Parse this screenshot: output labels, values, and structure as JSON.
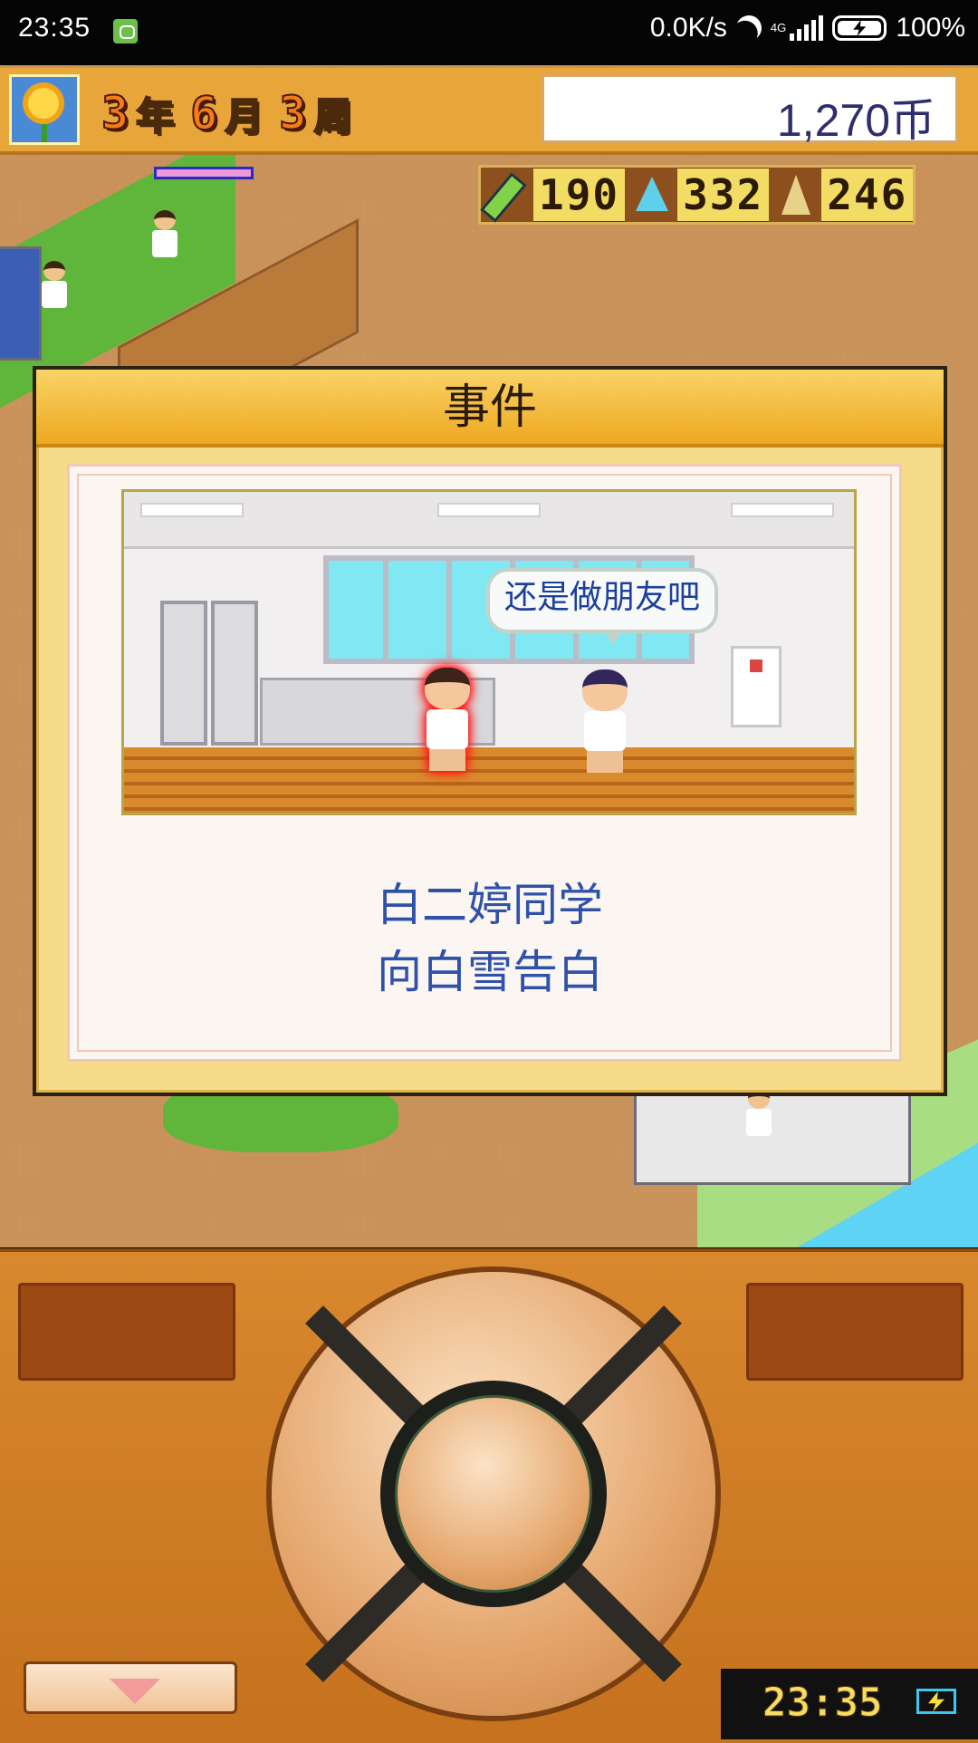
{
  "status_bar": {
    "time": "23:35",
    "net_speed": "0.0K/s",
    "network": "4G",
    "battery": "100%"
  },
  "hud": {
    "date": {
      "year_num": "3",
      "year_unit": "年",
      "month_num": "6",
      "month_unit": "月",
      "week_num": "3",
      "week_unit": "周"
    },
    "money": "1,270币",
    "stats": {
      "study": "190",
      "research": "332",
      "tower": "246"
    },
    "icons": [
      "sunflower-icon",
      "pencil-icon",
      "flask-icon",
      "tower-icon"
    ]
  },
  "event": {
    "title": "事件",
    "speech": "还是做朋友吧",
    "message_line1": "白二婷同学",
    "message_line2": "向白雪告白"
  },
  "controller": {
    "clock": "23:35",
    "icons": [
      "menu-arrow-down-icon",
      "battery-charging-icon"
    ]
  },
  "colors": {
    "hud_bg": "#e7a53a",
    "dialog_title_bg": "#f1c04a",
    "message_text": "#2f52a8",
    "controller_bg": "#d9882e"
  }
}
